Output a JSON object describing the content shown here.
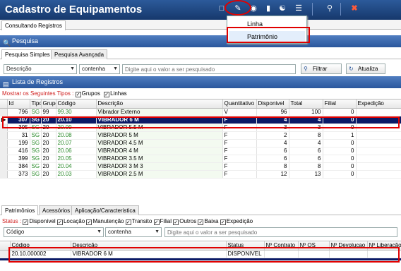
{
  "window": {
    "title": "Cadastro de Equipamentos"
  },
  "toolbar_menu": {
    "items": [
      {
        "label": "Linha"
      },
      {
        "label": "Patrimônio"
      }
    ]
  },
  "main_tab": {
    "label": "Consultando Registros"
  },
  "search": {
    "header": "Pesquisa",
    "tabs": [
      {
        "label": "Pesquisa Simples"
      },
      {
        "label": "Pesquisa Avançada"
      }
    ],
    "field": "Descrição",
    "operator": "contenha",
    "placeholder": "Digite aqui o valor a ser pesquisado",
    "filter_button": "Filtrar",
    "refresh_button": "Atualiza"
  },
  "list": {
    "header": "Lista de Registros",
    "show_types_label": "Mostrar os Seguintes Tipos :",
    "type_filters": [
      {
        "label": "Grupos"
      },
      {
        "label": "Linhas"
      }
    ],
    "columns": [
      "Id",
      "Tipo",
      "Grupo",
      "Código",
      "Descrição",
      "Quantitativo",
      "Disponivel",
      "Total",
      "Filial",
      "Expedição"
    ],
    "rows": [
      {
        "id": "796",
        "tipo": "SG",
        "grupo": "99",
        "codigo": "99.30",
        "descricao": "Vibrador Externo",
        "quant": "V",
        "disp": "96",
        "total": "100",
        "filial": "0",
        "exp": ""
      },
      {
        "id": "307",
        "tipo": "SG",
        "grupo": "20",
        "codigo": "20.10",
        "descricao": "VIBRADOR 6 M",
        "quant": "F",
        "disp": "4",
        "total": "4",
        "filial": "0",
        "exp": ""
      },
      {
        "id": "305",
        "tipo": "SG",
        "grupo": "20",
        "codigo": "20.09",
        "descricao": "VIBRADOR 5.5 M",
        "quant": "F",
        "disp": "3",
        "total": "3",
        "filial": "0",
        "exp": ""
      },
      {
        "id": "31",
        "tipo": "SG",
        "grupo": "20",
        "codigo": "20.08",
        "descricao": "VIBRADOR 5 M",
        "quant": "F",
        "disp": "2",
        "total": "8",
        "filial": "1",
        "exp": ""
      },
      {
        "id": "199",
        "tipo": "SG",
        "grupo": "20",
        "codigo": "20.07",
        "descricao": "VIBRADOR 4.5 M",
        "quant": "F",
        "disp": "4",
        "total": "4",
        "filial": "0",
        "exp": ""
      },
      {
        "id": "416",
        "tipo": "SG",
        "grupo": "20",
        "codigo": "20.06",
        "descricao": "VIBRADOR 4 M",
        "quant": "F",
        "disp": "6",
        "total": "6",
        "filial": "0",
        "exp": ""
      },
      {
        "id": "399",
        "tipo": "SG",
        "grupo": "20",
        "codigo": "20.05",
        "descricao": "VIBRADOR 3.5 M",
        "quant": "F",
        "disp": "6",
        "total": "6",
        "filial": "0",
        "exp": ""
      },
      {
        "id": "384",
        "tipo": "SG",
        "grupo": "20",
        "codigo": "20.04",
        "descricao": "VIBRADOR 3 M 3",
        "quant": "F",
        "disp": "8",
        "total": "8",
        "filial": "0",
        "exp": ""
      },
      {
        "id": "373",
        "tipo": "SG",
        "grupo": "20",
        "codigo": "20.03",
        "descricao": "VIBRADOR 2.5 M",
        "quant": "F",
        "disp": "12",
        "total": "13",
        "filial": "0",
        "exp": ""
      }
    ]
  },
  "detail": {
    "tabs": [
      {
        "label": "Patrimônios"
      },
      {
        "label": "Acessórios"
      },
      {
        "label": "Aplicação/Caracteristica"
      }
    ],
    "status_label": "Status :",
    "status_filters": [
      {
        "label": "Disponível"
      },
      {
        "label": "Locação"
      },
      {
        "label": "Manutenção"
      },
      {
        "label": "Transito"
      },
      {
        "label": "Filial"
      },
      {
        "label": "Outros"
      },
      {
        "label": "Baixa"
      },
      {
        "label": "Expedição"
      }
    ],
    "field": "Código",
    "operator": "contenha",
    "placeholder": "Digite aqui o valor a ser pesquisado",
    "columns": [
      "Código",
      "Descrição",
      "Status",
      "Nº Contrato",
      "Nº OS",
      "Nº Devolucao",
      "Nº Liberação"
    ],
    "rows": [
      {
        "codigo": "20.10.000002",
        "descricao": "VIBRADOR 6 M",
        "status": "DISPONIVEL"
      }
    ]
  },
  "colors": {
    "title_bar": "#1e4580",
    "selected_row": "#0b1a66",
    "highlight": "#e00000",
    "code_green": "#2a8a2a"
  }
}
